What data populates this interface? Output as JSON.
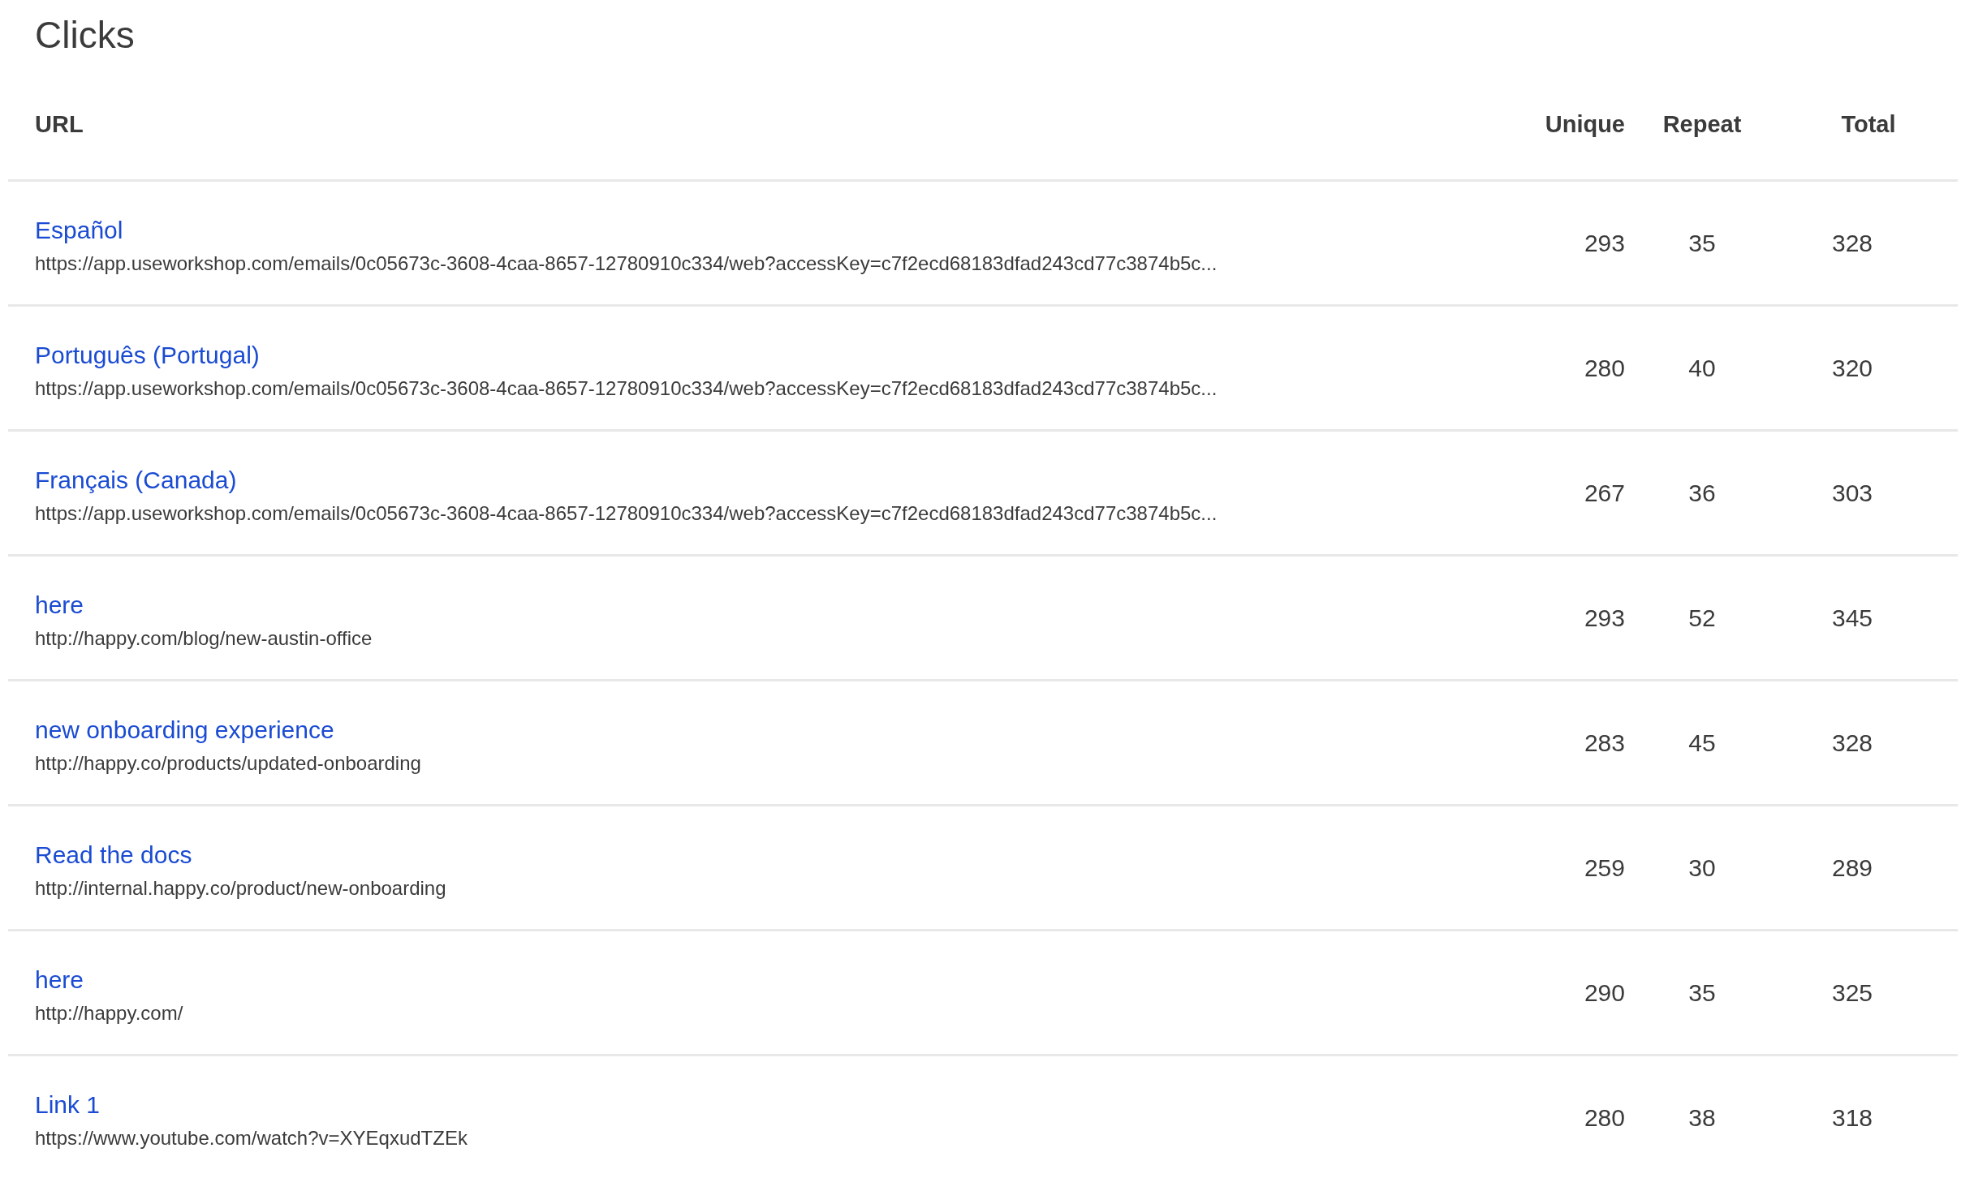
{
  "title": "Clicks",
  "table": {
    "columns": [
      "URL",
      "Unique",
      "Repeat",
      "Total"
    ],
    "rows": [
      {
        "link": "Español",
        "url": "https://app.useworkshop.com/emails/0c05673c-3608-4caa-8657-12780910c334/web?accessKey=c7f2ecd68183dfad243cd77c3874b5c...",
        "unique": "293",
        "repeat": "35",
        "total": "328"
      },
      {
        "link": "Português (Portugal)",
        "url": "https://app.useworkshop.com/emails/0c05673c-3608-4caa-8657-12780910c334/web?accessKey=c7f2ecd68183dfad243cd77c3874b5c...",
        "unique": "280",
        "repeat": "40",
        "total": "320"
      },
      {
        "link": "Français (Canada)",
        "url": "https://app.useworkshop.com/emails/0c05673c-3608-4caa-8657-12780910c334/web?accessKey=c7f2ecd68183dfad243cd77c3874b5c...",
        "unique": "267",
        "repeat": "36",
        "total": "303"
      },
      {
        "link": "here",
        "url": "http://happy.com/blog/new-austin-office",
        "unique": "293",
        "repeat": "52",
        "total": "345"
      },
      {
        "link": "new onboarding experience",
        "url": "http://happy.co/products/updated-onboarding",
        "unique": "283",
        "repeat": "45",
        "total": "328"
      },
      {
        "link": "Read the docs",
        "url": "http://internal.happy.co/product/new-onboarding",
        "unique": "259",
        "repeat": "30",
        "total": "289"
      },
      {
        "link": "here",
        "url": "http://happy.com/",
        "unique": "290",
        "repeat": "35",
        "total": "325"
      },
      {
        "link": "Link 1",
        "url": "https://www.youtube.com/watch?v=XYEqxudTZEk",
        "unique": "280",
        "repeat": "38",
        "total": "318"
      }
    ]
  }
}
